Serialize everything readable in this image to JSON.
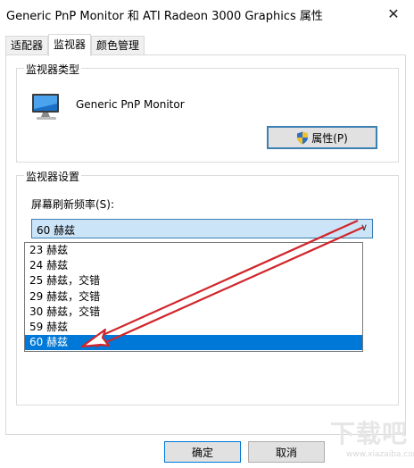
{
  "window": {
    "title": "Generic PnP Monitor 和 ATI Radeon 3000 Graphics 属性",
    "close_glyph": "✕"
  },
  "tabs": [
    {
      "label": "适配器",
      "active": false
    },
    {
      "label": "监视器",
      "active": true
    },
    {
      "label": "颜色管理",
      "active": false
    }
  ],
  "monitor_group": {
    "title": "监视器类型",
    "monitor_name": "Generic PnP Monitor",
    "properties_label": "属性(P)",
    "icon": "monitor-icon"
  },
  "settings_group": {
    "title": "监视器设置",
    "refresh_label": "屏幕刷新频率(S):",
    "selected_value": "60 赫兹",
    "options": [
      "23 赫兹",
      "24 赫兹",
      "25 赫兹，交错",
      "29 赫兹，交错",
      "30 赫兹，交错",
      "59 赫兹",
      "60 赫兹"
    ],
    "selected_index": 6
  },
  "footer": {
    "ok_label": "确定",
    "cancel_label": "取消"
  },
  "watermark": {
    "text": "下载吧",
    "sub": "www.xiazaiba.com"
  },
  "colors": {
    "accent": "#0078d7",
    "annotation_arrow": "#d0262b",
    "select_bg": "#cce4f7"
  }
}
